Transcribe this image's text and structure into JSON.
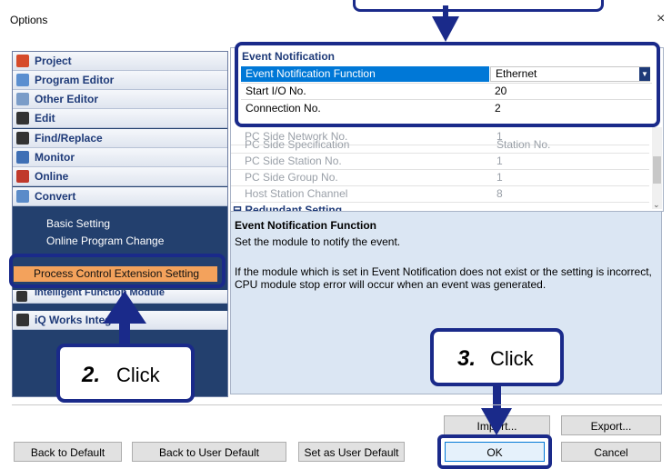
{
  "window": {
    "title": "Options",
    "close_glyph": "×"
  },
  "sidebar": {
    "categories": [
      {
        "label": "Project",
        "icon": "project-icon",
        "color": "#d64b2a"
      },
      {
        "label": "Program Editor",
        "icon": "program-editor-icon",
        "color": "#5b8fd0"
      },
      {
        "label": "Other Editor",
        "icon": "other-editor-icon",
        "color": "#7a9cc8"
      },
      {
        "label": "Edit",
        "icon": "edit-icon",
        "color": "#333333"
      },
      {
        "label": "Find/Replace",
        "icon": "binoculars-icon",
        "color": "#333333"
      },
      {
        "label": "Monitor",
        "icon": "monitor-icon",
        "color": "#3e6fb5"
      },
      {
        "label": "Online",
        "icon": "online-icon",
        "color": "#c0392b"
      },
      {
        "label": "Convert",
        "icon": "convert-icon",
        "color": "#5a8bc9"
      }
    ],
    "sub_items": [
      "Basic Setting",
      "Online Program Change"
    ],
    "selected_item": "Process Control Extension Setting",
    "lower_categories": [
      {
        "label": "Intelligent Function Module",
        "icon": "intelligent-module-icon"
      },
      {
        "label": "iQ Works Integration",
        "icon": "iq-works-icon"
      }
    ]
  },
  "grid": {
    "group": "Event Notification",
    "rows": [
      {
        "key": "Event Notification Function",
        "value": "Ethernet",
        "selected": true
      },
      {
        "key": "Start I/O No.",
        "value": "20"
      },
      {
        "key": "Connection No.",
        "value": "2"
      }
    ],
    "dim_rows": [
      {
        "key": "PC Side Network No.",
        "value": "1"
      },
      {
        "key": "PC Side Specification",
        "value": "Station No."
      },
      {
        "key": "PC Side Station No.",
        "value": "1"
      },
      {
        "key": "PC Side Group No.",
        "value": "1"
      },
      {
        "key": "Host Station Channel",
        "value": "8"
      }
    ],
    "next_group": "Redundant Setting"
  },
  "description": {
    "title": "Event Notification Function",
    "line1": "Set the module to notify the event.",
    "line2": "If the module which is set in Event Notification does not exist or the setting is incorrect,",
    "line3": "CPU module stop error will occur when an event was generated."
  },
  "callouts": {
    "step2": {
      "num": "2.",
      "text": "Click"
    },
    "step3": {
      "num": "3.",
      "text": "Click"
    }
  },
  "buttons": {
    "import": "Import...",
    "export": "Export...",
    "back_default": "Back to Default",
    "back_user_default": "Back to User Default",
    "set_user_default": "Set as User Default",
    "ok": "OK",
    "cancel": "Cancel"
  },
  "colors": {
    "accent": "#1a2a8a",
    "selected_row": "#0078d7",
    "highlight": "#f3a25c",
    "tree_bg": "#23406e"
  }
}
